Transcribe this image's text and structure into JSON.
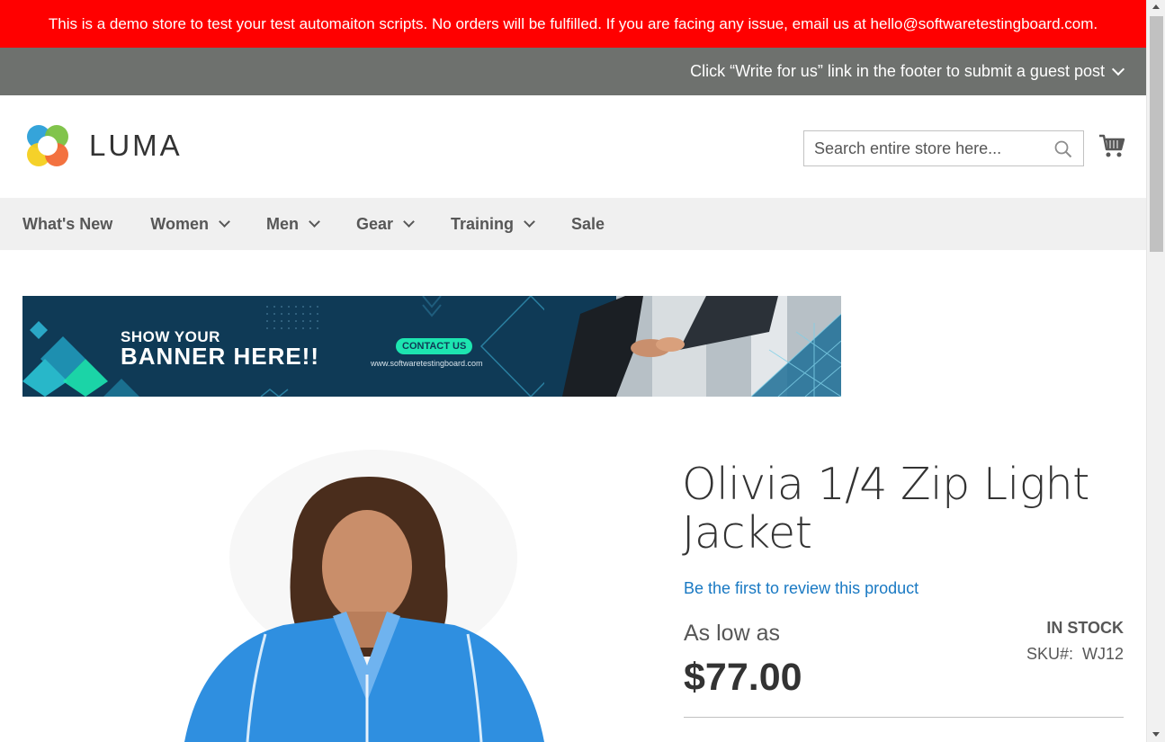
{
  "notice": {
    "text": "This is a demo store to test your test automaiton scripts. No orders will be fulfilled. If you are facing any issue, email us at hello@softwaretestingboard.com."
  },
  "guest_post": {
    "text": "Click “Write for us” link in the footer to submit a guest post"
  },
  "header": {
    "logo_text": "LUMA",
    "search_placeholder": "Search entire store here..."
  },
  "nav": {
    "items": [
      {
        "label": "What's New",
        "has_dropdown": false
      },
      {
        "label": "Women",
        "has_dropdown": true
      },
      {
        "label": "Men",
        "has_dropdown": true
      },
      {
        "label": "Gear",
        "has_dropdown": true
      },
      {
        "label": "Training",
        "has_dropdown": true
      },
      {
        "label": "Sale",
        "has_dropdown": false
      }
    ]
  },
  "banner": {
    "line1": "SHOW YOUR",
    "line2": "BANNER HERE!!",
    "button": "CONTACT US",
    "url": "www.softwaretestingboard.com"
  },
  "product": {
    "title": "Olivia 1/4 Zip Light Jacket",
    "review_link": "Be the first to review this product",
    "price_label": "As low as",
    "price": "$77.00",
    "stock": "IN STOCK",
    "sku_label": "SKU#:",
    "sku": "WJ12"
  },
  "colors": {
    "notice_bg": "#ff0000",
    "guest_bg": "#6e716e",
    "nav_bg": "#f0f0f0",
    "link": "#1979c3",
    "banner_bg": "#0f3a56",
    "banner_accent": "#1de5b0"
  }
}
